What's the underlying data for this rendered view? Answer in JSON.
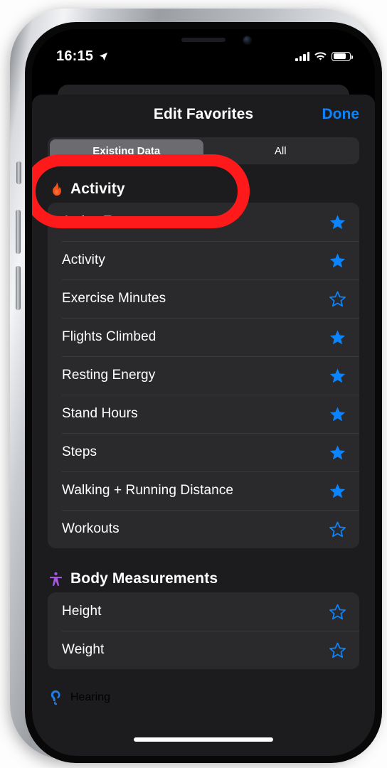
{
  "status_bar": {
    "time": "16:15",
    "location_icon": "location-arrow-icon",
    "cellular_icon": "cellular-bars-icon",
    "wifi_icon": "wifi-icon",
    "battery_icon": "battery-icon"
  },
  "sheet": {
    "title": "Edit Favorites",
    "done_label": "Done"
  },
  "segmented_control": {
    "options": [
      {
        "label": "Existing Data",
        "selected": true
      },
      {
        "label": "All",
        "selected": false
      }
    ]
  },
  "sections": [
    {
      "title": "Activity",
      "icon": "flame-icon",
      "icon_color": "#f4521b",
      "rows": [
        {
          "label": "Active Energy",
          "favorite": true
        },
        {
          "label": "Activity",
          "favorite": true
        },
        {
          "label": "Exercise Minutes",
          "favorite": false
        },
        {
          "label": "Flights Climbed",
          "favorite": true
        },
        {
          "label": "Resting Energy",
          "favorite": true
        },
        {
          "label": "Stand Hours",
          "favorite": true
        },
        {
          "label": "Steps",
          "favorite": true
        },
        {
          "label": "Walking + Running Distance",
          "favorite": true
        },
        {
          "label": "Workouts",
          "favorite": false
        }
      ]
    },
    {
      "title": "Body Measurements",
      "icon": "body-figure-icon",
      "icon_color": "#a855e0",
      "rows": [
        {
          "label": "Height",
          "favorite": false
        },
        {
          "label": "Weight",
          "favorite": false
        }
      ]
    },
    {
      "title": "Hearing",
      "icon": "ear-icon",
      "icon_color": "#1f7ee8",
      "rows": []
    }
  ],
  "colors": {
    "accent_blue": "#0a84ff",
    "star_blue": "#0b84ff",
    "annotation_red": "#fe1a1a",
    "sheet_bg": "#1c1c1e",
    "row_bg": "#2a2a2c"
  },
  "annotation": {
    "shape": "oval",
    "target": "Existing Data"
  }
}
